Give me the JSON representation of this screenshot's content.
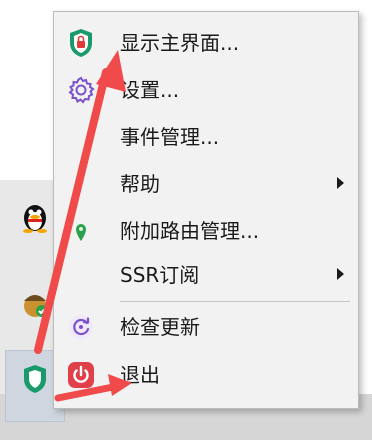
{
  "menu": {
    "items": [
      {
        "label": "显示主界面...",
        "icon": "shield-lock-icon",
        "has_submenu": false
      },
      {
        "label": "设置...",
        "icon": "gear-icon",
        "has_submenu": false
      },
      {
        "label": "事件管理...",
        "icon": "",
        "has_submenu": false
      },
      {
        "label": "帮助",
        "icon": "",
        "has_submenu": true
      },
      {
        "label": "附加路由管理...",
        "icon": "pin-icon",
        "has_submenu": false
      },
      {
        "label": "SSR订阅",
        "icon": "",
        "has_submenu": true
      },
      {
        "label": "检查更新",
        "icon": "refresh-icon",
        "has_submenu": false
      },
      {
        "label": "退出",
        "icon": "power-icon",
        "has_submenu": false
      }
    ]
  },
  "tray": {
    "icons": [
      "qq-penguin-icon",
      "acorn-icon",
      "shield-icon"
    ]
  },
  "colors": {
    "annotation_arrow": "#f04a4a",
    "shield_green": "#1a9a6b",
    "shield_red": "#e03a3a",
    "gear_purple": "#7b52c9",
    "power_red": "#e0404a",
    "pin_green": "#2aa14a"
  }
}
